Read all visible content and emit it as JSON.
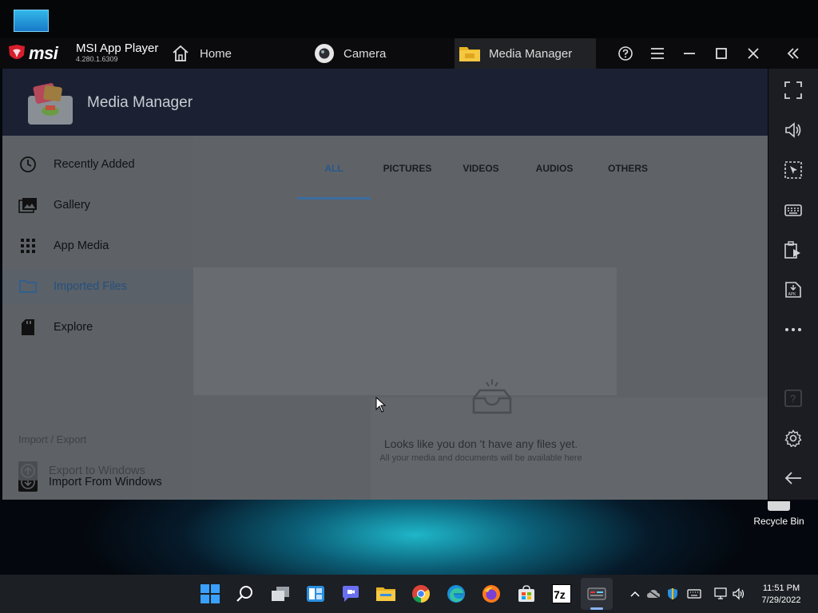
{
  "window": {
    "brand": "msi",
    "app_name": "MSI App Player",
    "version": "4.280.1.6309"
  },
  "tabs": [
    {
      "label": "Home",
      "icon": "home-icon"
    },
    {
      "label": "Camera",
      "icon": "camera-icon"
    },
    {
      "label": "Media Manager",
      "icon": "folder-icon",
      "active": true
    }
  ],
  "app": {
    "title": "Media Manager",
    "sidebar": {
      "items": [
        {
          "label": "Recently Added",
          "icon": "clock-icon"
        },
        {
          "label": "Gallery",
          "icon": "gallery-icon"
        },
        {
          "label": "App Media",
          "icon": "grid-icon"
        },
        {
          "label": "Imported Files",
          "icon": "folder-icon",
          "active": true
        },
        {
          "label": "Explore",
          "icon": "sd-card-icon"
        }
      ],
      "section_label": "Import / Export",
      "import_label": "Import From Windows",
      "export_label": "Export to Windows"
    },
    "tabs": [
      "ALL",
      "PICTURES",
      "VIDEOS",
      "AUDIOS",
      "OTHERS"
    ],
    "active_tab": "ALL",
    "empty_title": "Looks like you don 't have any files yet.",
    "empty_subtitle": "All your media and documents will be available here"
  },
  "desktop": {
    "recycle_bin": "Recycle Bin"
  },
  "taskbar": {
    "time": "11:51 PM",
    "date": "7/29/2022"
  },
  "colors": {
    "accent": "#3b6da1",
    "header": "#1b2133",
    "titlebar": "#0b0b0d"
  }
}
